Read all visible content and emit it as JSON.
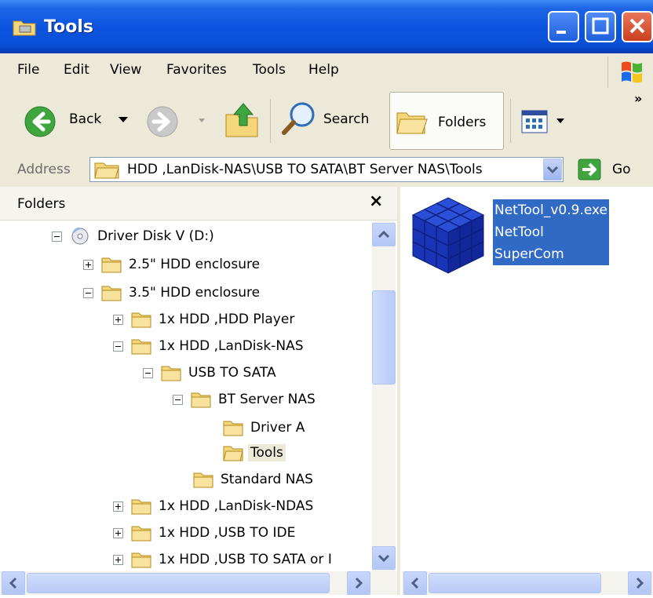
{
  "window": {
    "title": "Tools"
  },
  "menu": [
    "File",
    "Edit",
    "View",
    "Favorites",
    "Tools",
    "Help"
  ],
  "toolbar": {
    "back_label": "Back",
    "search_label": "Search",
    "folders_label": "Folders",
    "overflow": "»"
  },
  "address": {
    "label": "Address",
    "value": "HDD ,LanDisk-NAS\\USB TO SATA\\BT Server NAS\\Tools",
    "go_label": "Go"
  },
  "folders_pane": {
    "title": "Folders",
    "close": "×",
    "tree": [
      {
        "label": "Driver Disk V (D:)",
        "expander": "minus",
        "icon": "cd-drive-icon"
      },
      {
        "label": "2.5\" HDD enclosure",
        "expander": "plus",
        "icon": "folder-icon"
      },
      {
        "label": "3.5\" HDD enclosure",
        "expander": "minus",
        "icon": "folder-icon"
      },
      {
        "label": "1x HDD ,HDD Player",
        "expander": "plus",
        "icon": "folder-icon"
      },
      {
        "label": "1x HDD ,LanDisk-NAS",
        "expander": "minus",
        "icon": "folder-icon"
      },
      {
        "label": "USB TO SATA",
        "expander": "minus",
        "icon": "folder-icon"
      },
      {
        "label": "BT Server NAS",
        "expander": "minus",
        "icon": "folder-icon"
      },
      {
        "label": "Driver A",
        "expander": "none",
        "icon": "folder-icon"
      },
      {
        "label": "Tools",
        "expander": "none",
        "icon": "folder-open-icon",
        "selected": true
      },
      {
        "label": "Standard NAS",
        "expander": "none",
        "icon": "folder-icon"
      },
      {
        "label": "1x HDD ,LanDisk-NDAS",
        "expander": "plus",
        "icon": "folder-icon"
      },
      {
        "label": "1x HDD ,USB TO IDE",
        "expander": "plus",
        "icon": "folder-icon"
      },
      {
        "label": "1x HDD ,USB TO SATA or I",
        "expander": "plus",
        "icon": "folder-icon"
      }
    ]
  },
  "files": [
    {
      "name": "NetTool_v0.9.exe",
      "description": "NetTool",
      "company": "SuperCom",
      "icon": "cube-app-icon",
      "selected": true
    }
  ],
  "colors": {
    "titlebar": "#0a4fd6",
    "chrome": "#ece9d8",
    "selection": "#316ac5"
  }
}
